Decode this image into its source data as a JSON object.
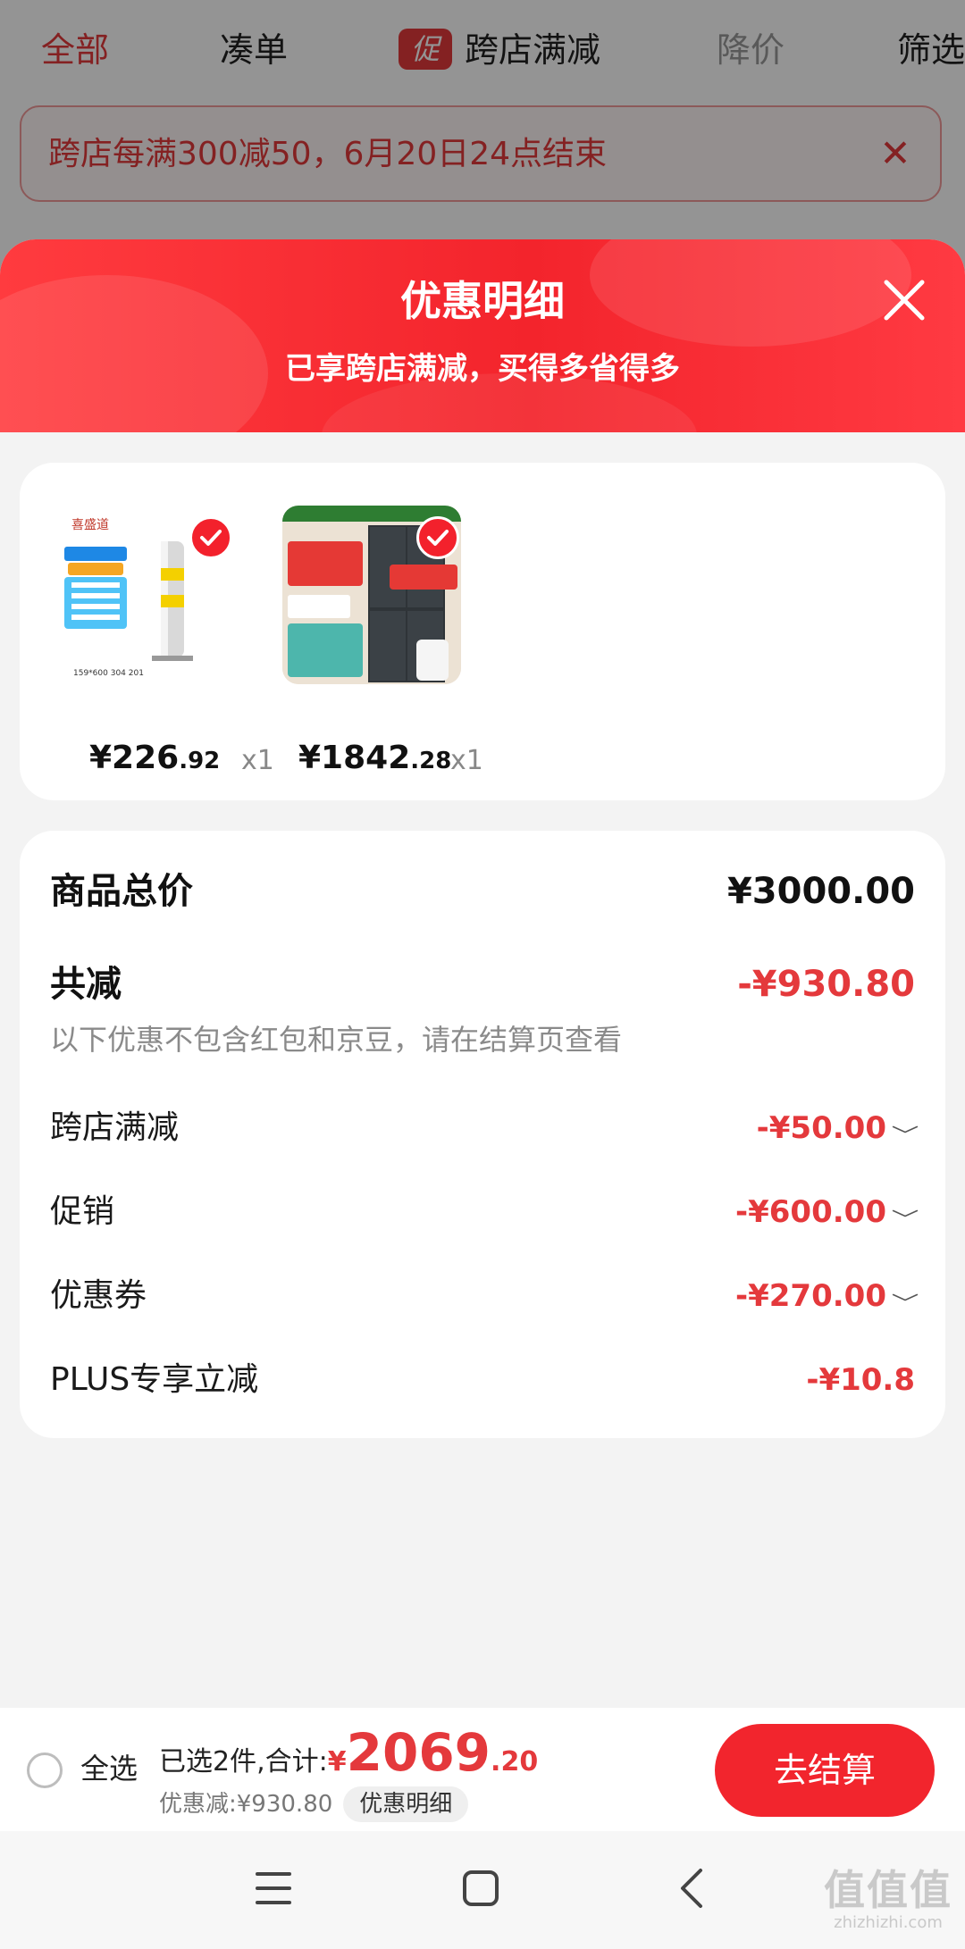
{
  "filter_tabs": [
    {
      "label": "全部",
      "state": "active"
    },
    {
      "label": "凑单",
      "state": "normal"
    },
    {
      "label": "跨店满减",
      "state": "normal",
      "badge": "促"
    },
    {
      "label": "降价",
      "state": "muted"
    },
    {
      "label": "筛选",
      "state": "normal"
    }
  ],
  "notice": {
    "text": "跨店每满300减50，6月20日24点结束",
    "close_icon": "close-icon"
  },
  "sheet": {
    "title": "优惠明细",
    "subtitle": "已享跨店满减，买得多省得多",
    "close_icon": "close-icon"
  },
  "products": [
    {
      "price_int": "¥226",
      "price_dec": ".92",
      "qty": "x1",
      "checked": true,
      "image": "stainless-bollard-product-image"
    },
    {
      "price_int": "¥1842",
      "price_dec": ".28",
      "qty": "x1",
      "checked": true,
      "image": "refrigerator-product-image"
    }
  ],
  "summary": {
    "total_label": "商品总价",
    "total_value": "¥3000.00",
    "reduce_label": "共减",
    "reduce_value": "-¥930.80",
    "note": "以下优惠不包含红包和京豆，请在结算页查看",
    "items": [
      {
        "label": "跨店满减",
        "value": "-¥50.00",
        "expandable": true
      },
      {
        "label": "促销",
        "value": "-¥600.00",
        "expandable": true
      },
      {
        "label": "优惠券",
        "value": "-¥270.00",
        "expandable": true
      },
      {
        "label": "PLUS专享立减",
        "value": "-¥10.8",
        "expandable": false
      }
    ]
  },
  "checkout": {
    "select_all": "全选",
    "selected_text": "已选2件,合计:",
    "total_symbol": "¥",
    "total_int": "2069",
    "total_dec": ".20",
    "discount_text": "优惠减:¥930.80",
    "detail_chip": "优惠明细",
    "button": "去结算"
  },
  "navbar": {
    "menu_icon": "menu-icon",
    "home_icon": "home-icon",
    "back_icon": "back-icon"
  },
  "watermark": {
    "logo": "值值值",
    "url": "zhizhizhi.com"
  },
  "colors": {
    "accent": "#e4393c",
    "header_red": "#f3242c",
    "sheet_bg": "#f3f3f3"
  }
}
